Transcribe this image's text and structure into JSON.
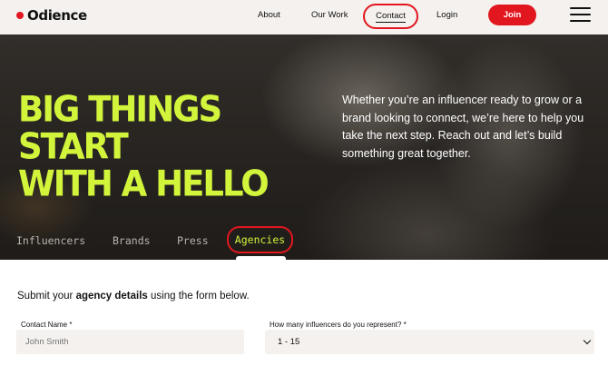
{
  "header": {
    "brand": "Odience",
    "nav": {
      "about": "About",
      "our_work": "Our Work",
      "contact": "Contact",
      "login": "Login",
      "join": "Join"
    }
  },
  "hero": {
    "title_line1": "BIG THINGS START",
    "title_line2": "WITH A HELLO",
    "description": "Whether you’re an influencer ready to grow or a brand looking to connect, we’re here to help you take the next step. Reach out and let’s build something great together.",
    "tabs": [
      "Influencers",
      "Brands",
      "Press",
      "Agencies"
    ],
    "active_tab": "Agencies"
  },
  "form": {
    "intro_prefix": "Submit your ",
    "intro_bold": "agency details",
    "intro_suffix": " using the form below.",
    "contact_name_label": "Contact Name *",
    "contact_name_placeholder": "John Smith",
    "influencer_count_label": "How many influencers do you represent? *",
    "influencer_count_value": "1 - 15"
  },
  "colors": {
    "accent_red": "#e2161f",
    "headline_lime": "#d2f53c",
    "header_bg": "#f4f1ee"
  },
  "icons": {
    "menu": "hamburger-menu-icon",
    "select": "chevron-down-icon"
  }
}
